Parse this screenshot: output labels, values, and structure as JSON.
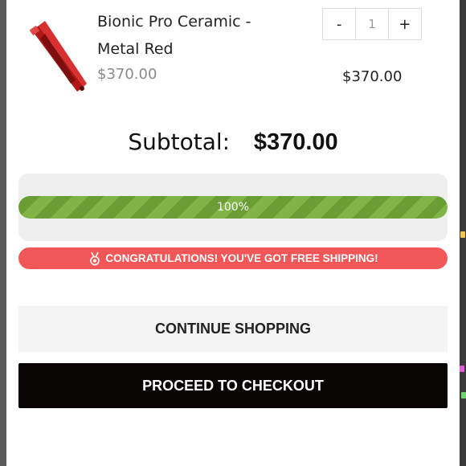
{
  "cart_item": {
    "title": "Bionic Pro Ceramic - Metal Red",
    "unit_price": "$370.00",
    "quantity": "1",
    "decrease_label": "-",
    "increase_label": "+",
    "line_total": "$370.00",
    "image_icon": "flat-iron-red"
  },
  "summary": {
    "subtotal_label": "Subtotal:",
    "subtotal_value": "$370.00"
  },
  "shipping_progress": {
    "percent": 100,
    "percent_label": "100%",
    "message": "CONGRATULATIONS! YOU'VE GOT FREE SHIPPING!",
    "message_icon": "medal-icon"
  },
  "actions": {
    "continue_label": "CONTINUE SHOPPING",
    "checkout_label": "PROCEED TO CHECKOUT"
  },
  "colors": {
    "progress_green": "#7db243",
    "congrats_red": "#f25757",
    "checkout_black": "#0a0505",
    "continue_bg": "#f4f4f4"
  }
}
